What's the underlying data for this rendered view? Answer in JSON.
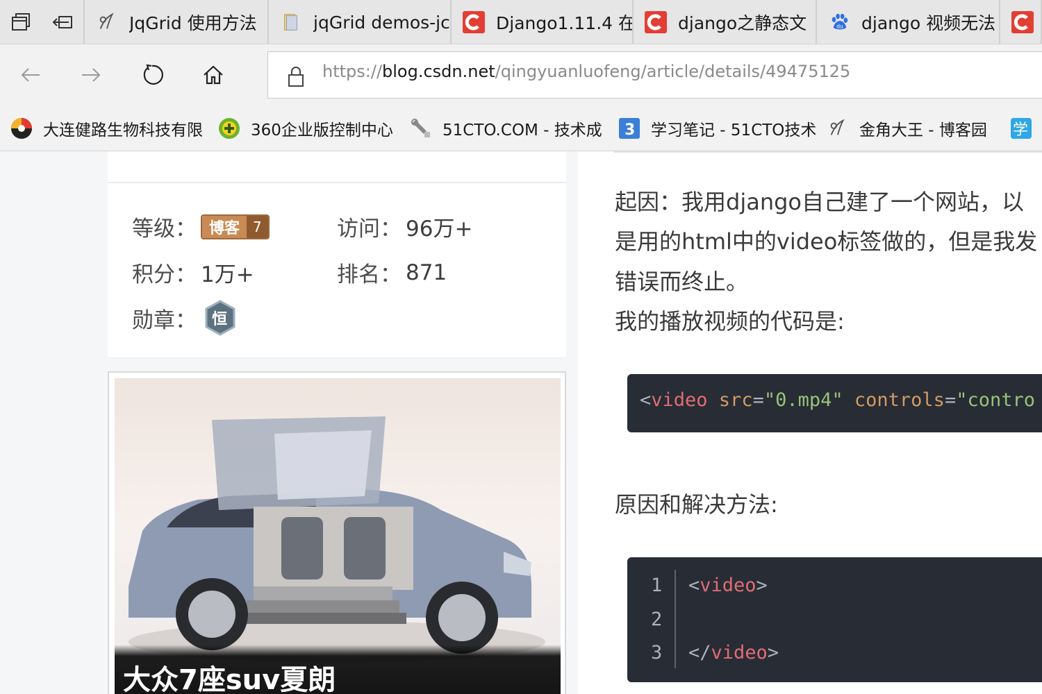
{
  "tabs": [
    {
      "label": "JqGrid 使用方法",
      "icon": "site-pen-icon"
    },
    {
      "label": "jqGrid demos-jc",
      "icon": "folder-file-icon"
    },
    {
      "label": "Django1.11.4 在",
      "icon": "csdn-icon"
    },
    {
      "label": "django之静态文",
      "icon": "csdn-icon"
    },
    {
      "label": "django 视频无法",
      "icon": "baidu-paw-icon"
    }
  ],
  "address": {
    "scheme": "https://",
    "host": "blog.csdn.net",
    "path": "/qingyuanluofeng/article/details/49475125"
  },
  "favorites": [
    {
      "label": "大连健路生物科技有限",
      "icon": "colorful-ball-icon"
    },
    {
      "label": "360企业版控制中心",
      "icon": "plus-circle-icon"
    },
    {
      "label": "51CTO.COM - 技术成",
      "icon": "wrench-icon"
    },
    {
      "label": "学习笔记 - 51CTO技术",
      "icon": "blue-3-icon"
    },
    {
      "label": "金角大王 - 博客园",
      "icon": "site-pen-icon"
    },
    {
      "label": "学",
      "icon": "learn-icon"
    }
  ],
  "profile": {
    "level_key": "等级：",
    "level_badge": "博客",
    "level_num": "7",
    "visits_key": "访问：",
    "visits_val": "96万+",
    "points_key": "积分：",
    "points_val": "1万+",
    "rank_key": "排名：",
    "rank_val": "871",
    "medal_key": "勋章：",
    "medal_char": "恒"
  },
  "ad": {
    "caption": "大众7座suv夏朗"
  },
  "article": {
    "para1_line1": "起因：我用django自己建了一个网站，以",
    "para1_line2": "是用的html中的video标签做的，但是我发",
    "para1_line3": "错误而终止。",
    "para1_line4": "我的播放视频的代码是:",
    "code1": {
      "lt": "<",
      "tag": "video",
      "attr1": " src",
      "eq1": "=",
      "val1": "\"0.mp4\"",
      "attr2": " controls",
      "eq2": "=",
      "val2": "\"contro"
    },
    "heading2": "原因和解决方法:",
    "code2_numbers": [
      "1",
      "2",
      "3"
    ],
    "code2_line1_open": "<",
    "code2_line1_tag": "video",
    "code2_line1_close": ">",
    "code2_line3_open": "</",
    "code2_line3_tag": "video",
    "code2_line3_close": ">"
  }
}
